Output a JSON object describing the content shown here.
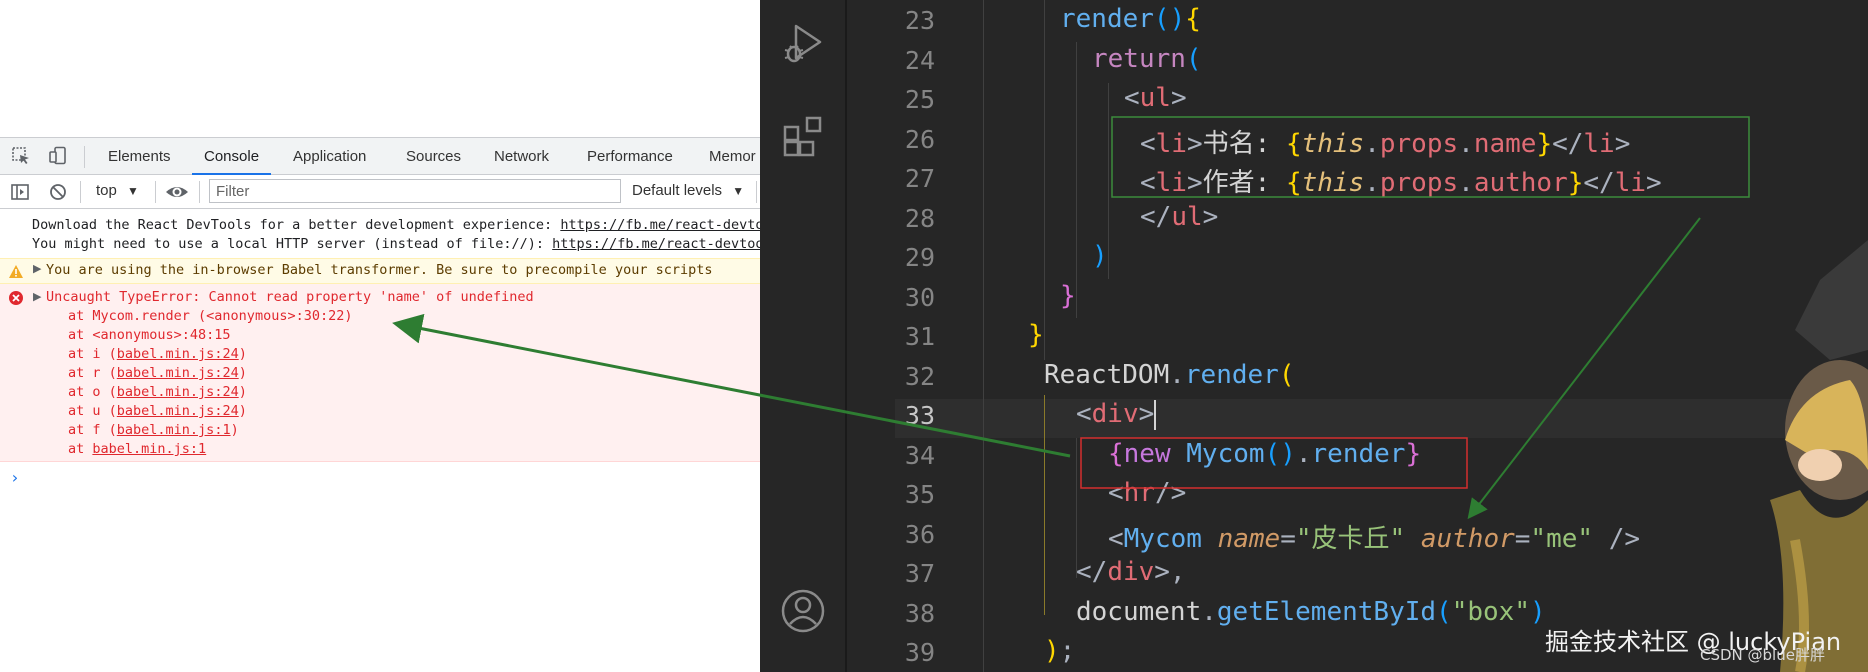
{
  "devtools": {
    "tabs": [
      "Elements",
      "Console",
      "Application",
      "Sources",
      "Network",
      "Performance",
      "Memor"
    ],
    "active_tab": "Console",
    "context": "top",
    "filter_placeholder": "Filter",
    "levels": "Default levels",
    "console": {
      "info_line_1": "Download the React DevTools for a better development experience: ",
      "info_link_1": "https://fb.me/react-devtools",
      "info_line_2": "You might need to use a local HTTP server (instead of file://): ",
      "info_link_2": "https://fb.me/react-devtools",
      "warning": "You are using the in-browser Babel transformer. Be sure to precompile your scripts",
      "error": "Uncaught TypeError: Cannot read property 'name' of undefined",
      "stack": [
        {
          "prefix": "at Mycom.render (",
          "link": "",
          "text": "<anonymous>:30:22)"
        },
        {
          "prefix": "at <anonymous>:48:15",
          "link": "",
          "text": ""
        },
        {
          "prefix": "at i (",
          "link": "babel.min.js:24",
          "text": ")"
        },
        {
          "prefix": "at r (",
          "link": "babel.min.js:24",
          "text": ")"
        },
        {
          "prefix": "at o (",
          "link": "babel.min.js:24",
          "text": ")"
        },
        {
          "prefix": "at u (",
          "link": "babel.min.js:24",
          "text": ")"
        },
        {
          "prefix": "at f (",
          "link": "babel.min.js:1",
          "text": ")"
        },
        {
          "prefix": "at ",
          "link": "babel.min.js:1",
          "text": ""
        }
      ],
      "prompt": "›"
    }
  },
  "editor": {
    "line_numbers": [
      "23",
      "24",
      "25",
      "26",
      "27",
      "28",
      "29",
      "30",
      "31",
      "32",
      "33",
      "34",
      "35",
      "36",
      "37",
      "38",
      "39"
    ],
    "current_line": "33",
    "tokens": {
      "render": "render",
      "return": "return",
      "ul": "ul",
      "li": "li",
      "book_name": "书名: ",
      "author_cn": "作者: ",
      "this": "this",
      "props": "props",
      "name": "name",
      "author": "author",
      "reactdom": "ReactDOM",
      "div": "div",
      "new": "new",
      "mycom": "Mycom",
      "hr": "hr",
      "pikachu": "\"皮卡丘\"",
      "me": "\"me\"",
      "document": "document",
      "getelementbyid": "getElementById",
      "box": "\"box\""
    }
  },
  "watermark": {
    "main": "掘金技术社区 @ luckyPian",
    "sub": "CSDN @blue胖胖"
  },
  "annotation_colors": {
    "arrow": "#2e7d32",
    "highlight_box_green": "#3c8c3c",
    "highlight_box_red": "#d32f2f"
  }
}
